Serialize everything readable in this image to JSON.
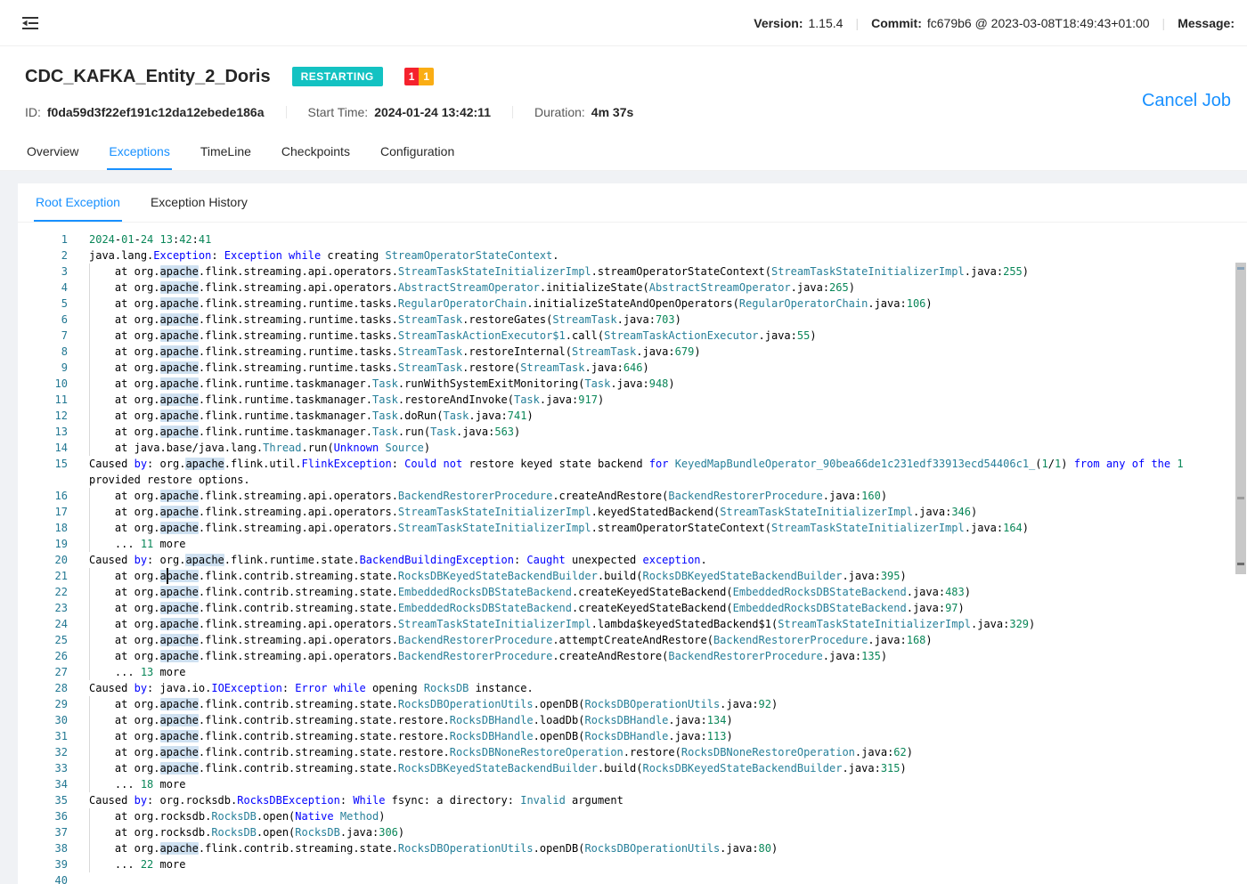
{
  "topbar": {
    "version_label": "Version:",
    "version_value": "1.15.4",
    "commit_label": "Commit:",
    "commit_value": "fc679b6 @ 2023-03-08T18:49:43+01:00",
    "message_label": "Message:",
    "separator": "|"
  },
  "job": {
    "title": "CDC_KAFKA_Entity_2_Doris",
    "status_badge": "RESTARTING",
    "status_color": "#13c2c2",
    "count_badges": [
      {
        "value": "1",
        "color": "#f5222d"
      },
      {
        "value": "1",
        "color": "#faad14"
      }
    ],
    "id_label": "ID:",
    "id_value": "f0da59d3f22ef191c12da12ebede186a",
    "start_time_label": "Start Time:",
    "start_time_value": "2024-01-24 13:42:11",
    "duration_label": "Duration:",
    "duration_value": "4m 37s",
    "cancel_button": "Cancel Job"
  },
  "tabs": [
    {
      "label": "Overview",
      "active": false
    },
    {
      "label": "Exceptions",
      "active": true
    },
    {
      "label": "TimeLine",
      "active": false
    },
    {
      "label": "Checkpoints",
      "active": false
    },
    {
      "label": "Configuration",
      "active": false
    }
  ],
  "subtabs": [
    {
      "label": "Root Exception",
      "active": true
    },
    {
      "label": "Exception History",
      "active": false
    }
  ],
  "editor": {
    "highlight_word": "apache",
    "cursor": {
      "line": 21,
      "column_ch": 12
    },
    "colors": {
      "keyword": "#0000ff",
      "type": "#267f99",
      "number": "#098658",
      "default": "#000000",
      "line_number": "#237893",
      "word_highlight": "rgba(38,119,193,0.22)"
    },
    "syntax": {
      "blue_words": [
        "Exception",
        "exception",
        "while",
        "While",
        "by",
        "not",
        "for",
        "from",
        "any",
        "of",
        "the",
        "Could",
        "Caught",
        "Error",
        "Native",
        "Unknown"
      ],
      "plain_words": [
        "Caused"
      ]
    },
    "lines": [
      "2024-01-24 13:42:41",
      "java.lang.Exception: Exception while creating StreamOperatorStateContext.",
      "\tat org.apache.flink.streaming.api.operators.StreamTaskStateInitializerImpl.streamOperatorStateContext(StreamTaskStateInitializerImpl.java:255)",
      "\tat org.apache.flink.streaming.api.operators.AbstractStreamOperator.initializeState(AbstractStreamOperator.java:265)",
      "\tat org.apache.flink.streaming.runtime.tasks.RegularOperatorChain.initializeStateAndOpenOperators(RegularOperatorChain.java:106)",
      "\tat org.apache.flink.streaming.runtime.tasks.StreamTask.restoreGates(StreamTask.java:703)",
      "\tat org.apache.flink.streaming.runtime.tasks.StreamTaskActionExecutor$1.call(StreamTaskActionExecutor.java:55)",
      "\tat org.apache.flink.streaming.runtime.tasks.StreamTask.restoreInternal(StreamTask.java:679)",
      "\tat org.apache.flink.streaming.runtime.tasks.StreamTask.restore(StreamTask.java:646)",
      "\tat org.apache.flink.runtime.taskmanager.Task.runWithSystemExitMonitoring(Task.java:948)",
      "\tat org.apache.flink.runtime.taskmanager.Task.restoreAndInvoke(Task.java:917)",
      "\tat org.apache.flink.runtime.taskmanager.Task.doRun(Task.java:741)",
      "\tat org.apache.flink.runtime.taskmanager.Task.run(Task.java:563)",
      "\tat java.base/java.lang.Thread.run(Unknown Source)",
      "Caused by: org.apache.flink.util.FlinkException: Could not restore keyed state backend for KeyedMapBundleOperator_90bea66de1c231edf33913ecd54406c1_(1/1) from any of the 1 provided restore options.",
      "\tat org.apache.flink.streaming.api.operators.BackendRestorerProcedure.createAndRestore(BackendRestorerProcedure.java:160)",
      "\tat org.apache.flink.streaming.api.operators.StreamTaskStateInitializerImpl.keyedStatedBackend(StreamTaskStateInitializerImpl.java:346)",
      "\tat org.apache.flink.streaming.api.operators.StreamTaskStateInitializerImpl.streamOperatorStateContext(StreamTaskStateInitializerImpl.java:164)",
      "\t... 11 more",
      "Caused by: org.apache.flink.runtime.state.BackendBuildingException: Caught unexpected exception.",
      "\tat org.apache.flink.contrib.streaming.state.RocksDBKeyedStateBackendBuilder.build(RocksDBKeyedStateBackendBuilder.java:395)",
      "\tat org.apache.flink.contrib.streaming.state.EmbeddedRocksDBStateBackend.createKeyedStateBackend(EmbeddedRocksDBStateBackend.java:483)",
      "\tat org.apache.flink.contrib.streaming.state.EmbeddedRocksDBStateBackend.createKeyedStateBackend(EmbeddedRocksDBStateBackend.java:97)",
      "\tat org.apache.flink.streaming.api.operators.StreamTaskStateInitializerImpl.lambda$keyedStatedBackend$1(StreamTaskStateInitializerImpl.java:329)",
      "\tat org.apache.flink.streaming.api.operators.BackendRestorerProcedure.attemptCreateAndRestore(BackendRestorerProcedure.java:168)",
      "\tat org.apache.flink.streaming.api.operators.BackendRestorerProcedure.createAndRestore(BackendRestorerProcedure.java:135)",
      "\t... 13 more",
      "Caused by: java.io.IOException: Error while opening RocksDB instance.",
      "\tat org.apache.flink.contrib.streaming.state.RocksDBOperationUtils.openDB(RocksDBOperationUtils.java:92)",
      "\tat org.apache.flink.contrib.streaming.state.restore.RocksDBHandle.loadDb(RocksDBHandle.java:134)",
      "\tat org.apache.flink.contrib.streaming.state.restore.RocksDBHandle.openDB(RocksDBHandle.java:113)",
      "\tat org.apache.flink.contrib.streaming.state.restore.RocksDBNoneRestoreOperation.restore(RocksDBNoneRestoreOperation.java:62)",
      "\tat org.apache.flink.contrib.streaming.state.RocksDBKeyedStateBackendBuilder.build(RocksDBKeyedStateBackendBuilder.java:315)",
      "\t... 18 more",
      "Caused by: org.rocksdb.RocksDBException: While fsync: a directory: Invalid argument",
      "\tat org.rocksdb.RocksDB.open(Native Method)",
      "\tat org.rocksdb.RocksDB.open(RocksDB.java:306)",
      "\tat org.apache.flink.contrib.streaming.state.RocksDBOperationUtils.openDB(RocksDBOperationUtils.java:80)",
      "\t... 22 more",
      ""
    ]
  }
}
